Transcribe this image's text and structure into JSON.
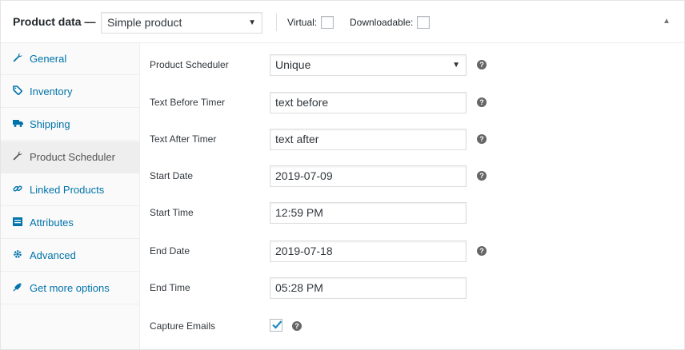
{
  "header": {
    "title": "Product data —",
    "product_type": "Simple product",
    "virtual_label": "Virtual:",
    "downloadable_label": "Downloadable:",
    "virtual_checked": false,
    "downloadable_checked": false
  },
  "sidebar": {
    "items": [
      {
        "label": "General",
        "icon": "wrench-icon",
        "active": false
      },
      {
        "label": "Inventory",
        "icon": "tag-icon",
        "active": false
      },
      {
        "label": "Shipping",
        "icon": "truck-icon",
        "active": false
      },
      {
        "label": "Product Scheduler",
        "icon": "wrench-icon",
        "active": true
      },
      {
        "label": "Linked Products",
        "icon": "link-icon",
        "active": false
      },
      {
        "label": "Attributes",
        "icon": "list-icon",
        "active": false
      },
      {
        "label": "Advanced",
        "icon": "gear-icon",
        "active": false
      },
      {
        "label": "Get more options",
        "icon": "plug-icon",
        "active": false
      }
    ]
  },
  "fields": {
    "product_scheduler": {
      "label": "Product Scheduler",
      "value": "Unique"
    },
    "text_before_timer": {
      "label": "Text Before Timer",
      "value": "text before"
    },
    "text_after_timer": {
      "label": "Text After Timer",
      "value": "text after"
    },
    "start_date": {
      "label": "Start Date",
      "value": "2019-07-09"
    },
    "start_time": {
      "label": "Start Time",
      "value": "12:59 PM"
    },
    "end_date": {
      "label": "End Date",
      "value": "2019-07-18"
    },
    "end_time": {
      "label": "End Time",
      "value": "05:28 PM"
    },
    "capture_emails": {
      "label": "Capture Emails",
      "checked": true
    }
  },
  "colors": {
    "link": "#0073aa",
    "help_icon": "#666666",
    "checkmark": "#1e8cbe"
  }
}
